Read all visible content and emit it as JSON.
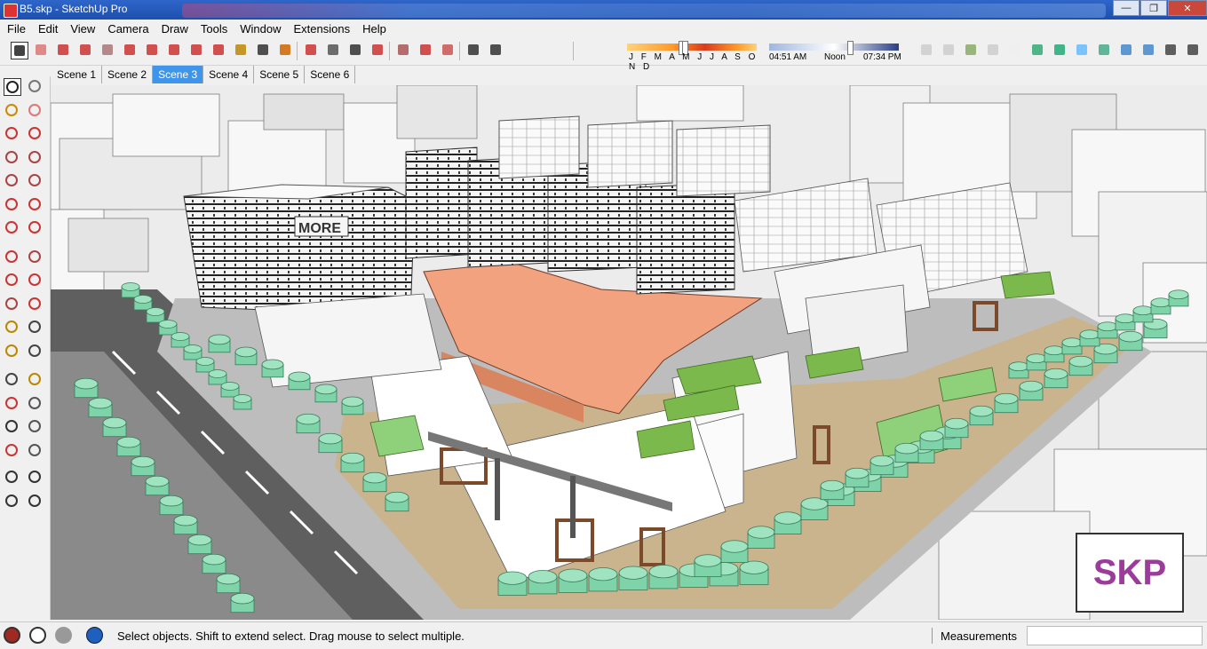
{
  "window": {
    "title": "B5.skp - SketchUp Pro",
    "controls": [
      "minimize",
      "restore",
      "close"
    ]
  },
  "menu": [
    "File",
    "Edit",
    "View",
    "Camera",
    "Draw",
    "Tools",
    "Window",
    "Extensions",
    "Help"
  ],
  "shadow": {
    "months_label": "J F M A M J J A S O N D",
    "time_start": "04:51 AM",
    "time_noon": "Noon",
    "time_end": "07:34 PM"
  },
  "scenes": [
    "Scene 1",
    "Scene 2",
    "Scene 3",
    "Scene 4",
    "Scene 5",
    "Scene 6"
  ],
  "active_scene": "Scene 3",
  "viewport": {
    "sign_text": "MORE",
    "watermark": "SKP",
    "colors": {
      "roof_accent": "#f2a27e",
      "green_roof": "#7cb94d",
      "trees": "#7ed3a8",
      "road": "#5f5f5f",
      "paving": "#c9b48e",
      "wood": "#7a4a2a"
    }
  },
  "status": {
    "message": "Select objects. Shift to extend select. Drag mouse to select multiple.",
    "measurements_label": "Measurements",
    "measurements_value": ""
  },
  "icons": {
    "top_toolbar": [
      "select-icon",
      "eraser-icon",
      "pencil-icon",
      "arc-icon",
      "circle-icon",
      "push-pull-icon",
      "follow-me-icon",
      "move-icon",
      "rotate-icon",
      "scale-icon",
      "tape-measure-icon",
      "text-icon",
      "paint-bucket-icon",
      "orbit-icon",
      "pan-icon",
      "zoom-icon",
      "zoom-extents-icon",
      "warehouse-icon",
      "extension-icon",
      "styles-icon",
      "layout-icon",
      "shadows-icon",
      "fog-icon",
      "section-icon",
      "view-iso-icon",
      "view-top-icon",
      "view-front-icon",
      "view-right-icon",
      "view-back-icon",
      "view-left-icon",
      "xray-icon",
      "wireframe-icon",
      "hidden-line-icon",
      "shaded-icon",
      "shaded-texture-icon",
      "monochrome-icon"
    ],
    "left_toolbar": [
      "select-icon",
      "component-icon",
      "paint-bucket-icon",
      "eraser-icon",
      "line-icon",
      "freehand-icon",
      "rectangle-icon",
      "rotated-rect-icon",
      "circle-icon",
      "polygon-icon",
      "arc-icon",
      "pie-icon",
      "arc-3pt-icon",
      "two-point-arc-icon",
      "move-icon",
      "push-pull-icon",
      "rotate-icon",
      "follow-me-icon",
      "scale-icon",
      "offset-icon",
      "tape-icon",
      "dimension-icon",
      "protractor-icon",
      "text-icon",
      "axes-icon",
      "3d-text-icon",
      "orbit-icon",
      "pan-icon",
      "zoom-icon",
      "zoom-window-icon",
      "zoom-extents-icon",
      "previous-view-icon",
      "position-camera-icon",
      "look-around-icon",
      "walk-icon",
      "section-plane-icon"
    ],
    "status_bar": [
      "geo-location-icon",
      "credits-icon",
      "user-icon",
      "help-icon"
    ]
  }
}
